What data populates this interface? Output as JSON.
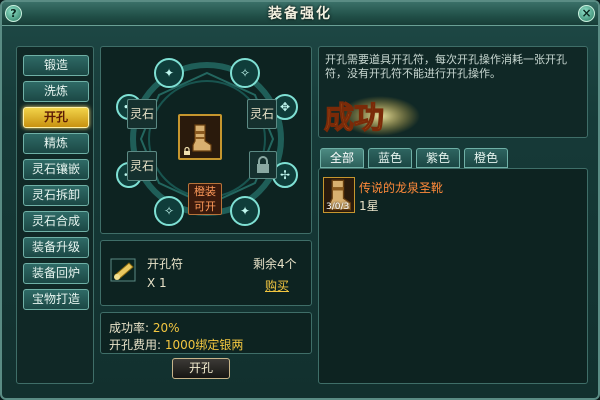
{
  "window": {
    "title": "装备强化",
    "help_label": "?",
    "close_label": "×"
  },
  "menu": {
    "items": [
      "锻造",
      "洗炼",
      "开孔",
      "精炼",
      "灵石镶嵌",
      "灵石拆卸",
      "灵石合成",
      "装备升级",
      "装备回炉",
      "宝物打造"
    ],
    "active": "开孔"
  },
  "wheel": {
    "slots": [
      "灵石",
      "灵石",
      "灵石"
    ],
    "open_label": [
      "橙装",
      "可开"
    ]
  },
  "item": {
    "name": "开孔符",
    "quantity": "X 1",
    "remaining": "剩余4个",
    "buy_label": "购买"
  },
  "cost": {
    "rate_label": "成功率:",
    "rate_value": "20%",
    "fee_label": "开孔费用:",
    "fee_value": "1000绑定银两"
  },
  "open_button": "开孔",
  "description": "开孔需要道具开孔符，每次开孔操作消耗一张开孔符，没有开孔符不能进行开孔操作。",
  "success_text": "成功",
  "tabs": [
    "全部",
    "蓝色",
    "紫色",
    "橙色"
  ],
  "list": [
    {
      "name": "传说的龙泉圣靴",
      "star": "1星",
      "count": "3/0/3"
    }
  ],
  "colors": {
    "accent": "#f2c640",
    "orange_item": "#ff8a3a",
    "panel": "#0d2321"
  }
}
